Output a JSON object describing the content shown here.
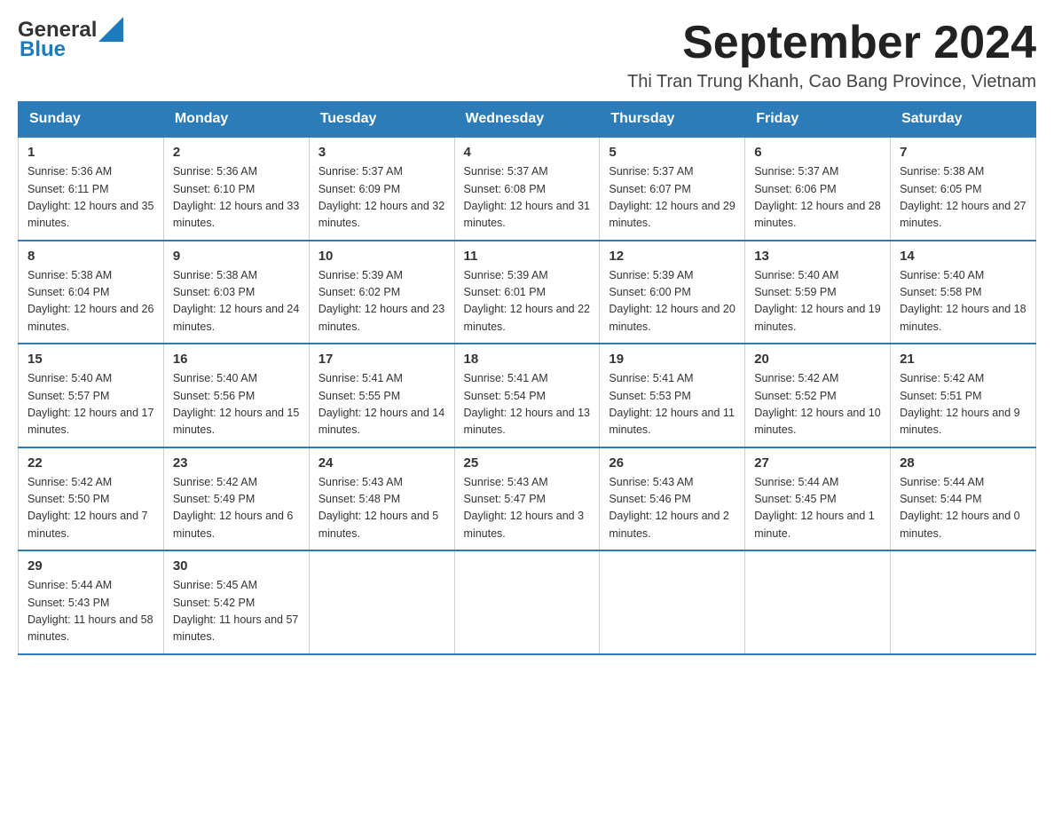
{
  "header": {
    "logo_general": "General",
    "logo_blue": "Blue",
    "month_title": "September 2024",
    "location": "Thi Tran Trung Khanh, Cao Bang Province, Vietnam"
  },
  "weekdays": [
    "Sunday",
    "Monday",
    "Tuesday",
    "Wednesday",
    "Thursday",
    "Friday",
    "Saturday"
  ],
  "weeks": [
    [
      {
        "day": "1",
        "sunrise": "5:36 AM",
        "sunset": "6:11 PM",
        "daylight": "12 hours and 35 minutes."
      },
      {
        "day": "2",
        "sunrise": "5:36 AM",
        "sunset": "6:10 PM",
        "daylight": "12 hours and 33 minutes."
      },
      {
        "day": "3",
        "sunrise": "5:37 AM",
        "sunset": "6:09 PM",
        "daylight": "12 hours and 32 minutes."
      },
      {
        "day": "4",
        "sunrise": "5:37 AM",
        "sunset": "6:08 PM",
        "daylight": "12 hours and 31 minutes."
      },
      {
        "day": "5",
        "sunrise": "5:37 AM",
        "sunset": "6:07 PM",
        "daylight": "12 hours and 29 minutes."
      },
      {
        "day": "6",
        "sunrise": "5:37 AM",
        "sunset": "6:06 PM",
        "daylight": "12 hours and 28 minutes."
      },
      {
        "day": "7",
        "sunrise": "5:38 AM",
        "sunset": "6:05 PM",
        "daylight": "12 hours and 27 minutes."
      }
    ],
    [
      {
        "day": "8",
        "sunrise": "5:38 AM",
        "sunset": "6:04 PM",
        "daylight": "12 hours and 26 minutes."
      },
      {
        "day": "9",
        "sunrise": "5:38 AM",
        "sunset": "6:03 PM",
        "daylight": "12 hours and 24 minutes."
      },
      {
        "day": "10",
        "sunrise": "5:39 AM",
        "sunset": "6:02 PM",
        "daylight": "12 hours and 23 minutes."
      },
      {
        "day": "11",
        "sunrise": "5:39 AM",
        "sunset": "6:01 PM",
        "daylight": "12 hours and 22 minutes."
      },
      {
        "day": "12",
        "sunrise": "5:39 AM",
        "sunset": "6:00 PM",
        "daylight": "12 hours and 20 minutes."
      },
      {
        "day": "13",
        "sunrise": "5:40 AM",
        "sunset": "5:59 PM",
        "daylight": "12 hours and 19 minutes."
      },
      {
        "day": "14",
        "sunrise": "5:40 AM",
        "sunset": "5:58 PM",
        "daylight": "12 hours and 18 minutes."
      }
    ],
    [
      {
        "day": "15",
        "sunrise": "5:40 AM",
        "sunset": "5:57 PM",
        "daylight": "12 hours and 17 minutes."
      },
      {
        "day": "16",
        "sunrise": "5:40 AM",
        "sunset": "5:56 PM",
        "daylight": "12 hours and 15 minutes."
      },
      {
        "day": "17",
        "sunrise": "5:41 AM",
        "sunset": "5:55 PM",
        "daylight": "12 hours and 14 minutes."
      },
      {
        "day": "18",
        "sunrise": "5:41 AM",
        "sunset": "5:54 PM",
        "daylight": "12 hours and 13 minutes."
      },
      {
        "day": "19",
        "sunrise": "5:41 AM",
        "sunset": "5:53 PM",
        "daylight": "12 hours and 11 minutes."
      },
      {
        "day": "20",
        "sunrise": "5:42 AM",
        "sunset": "5:52 PM",
        "daylight": "12 hours and 10 minutes."
      },
      {
        "day": "21",
        "sunrise": "5:42 AM",
        "sunset": "5:51 PM",
        "daylight": "12 hours and 9 minutes."
      }
    ],
    [
      {
        "day": "22",
        "sunrise": "5:42 AM",
        "sunset": "5:50 PM",
        "daylight": "12 hours and 7 minutes."
      },
      {
        "day": "23",
        "sunrise": "5:42 AM",
        "sunset": "5:49 PM",
        "daylight": "12 hours and 6 minutes."
      },
      {
        "day": "24",
        "sunrise": "5:43 AM",
        "sunset": "5:48 PM",
        "daylight": "12 hours and 5 minutes."
      },
      {
        "day": "25",
        "sunrise": "5:43 AM",
        "sunset": "5:47 PM",
        "daylight": "12 hours and 3 minutes."
      },
      {
        "day": "26",
        "sunrise": "5:43 AM",
        "sunset": "5:46 PM",
        "daylight": "12 hours and 2 minutes."
      },
      {
        "day": "27",
        "sunrise": "5:44 AM",
        "sunset": "5:45 PM",
        "daylight": "12 hours and 1 minute."
      },
      {
        "day": "28",
        "sunrise": "5:44 AM",
        "sunset": "5:44 PM",
        "daylight": "12 hours and 0 minutes."
      }
    ],
    [
      {
        "day": "29",
        "sunrise": "5:44 AM",
        "sunset": "5:43 PM",
        "daylight": "11 hours and 58 minutes."
      },
      {
        "day": "30",
        "sunrise": "5:45 AM",
        "sunset": "5:42 PM",
        "daylight": "11 hours and 57 minutes."
      },
      null,
      null,
      null,
      null,
      null
    ]
  ]
}
